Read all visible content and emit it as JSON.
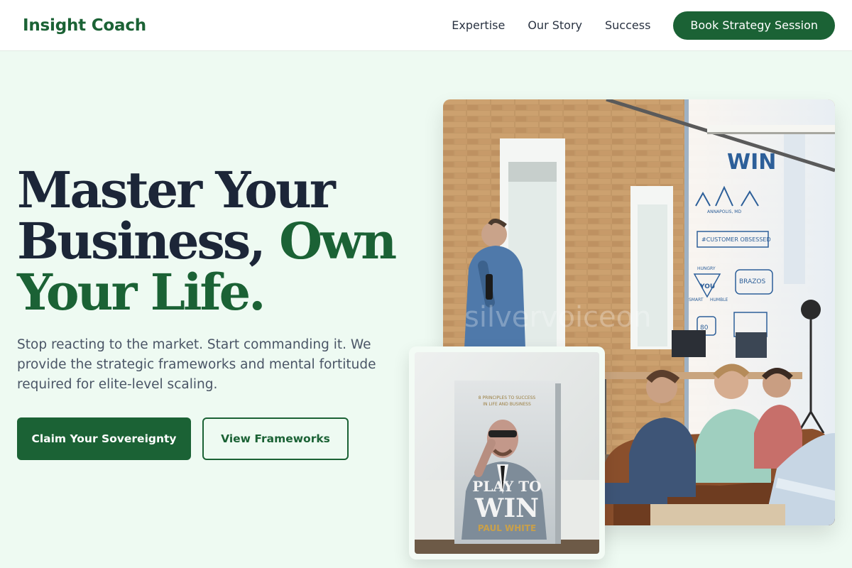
{
  "nav": {
    "brand": "Insight Coach",
    "links": [
      "Expertise",
      "Our Story",
      "Success"
    ],
    "cta": "Book Strategy Session"
  },
  "hero": {
    "title_line1": "Master Your",
    "title_line2_dark": "Business,",
    "title_line2_accent": "Own",
    "title_line3_accent": "Your Life.",
    "subtitle": "Stop reacting to the market. Start commanding it. We provide the strategic frameworks and mental fortitude required for elite-level scaling.",
    "primary_button": "Claim Your Sovereignty",
    "secondary_button": "View Frameworks"
  },
  "photo_main": {
    "mural_win": "WIN",
    "mural_city": "ANNAPOLIS, MD",
    "mural_banner": "#CUSTOMER OBSESSED",
    "mural_hungry": "HUNGRY",
    "mural_you": "YOU",
    "mural_smart": "SMART",
    "mural_humble": "HUMBLE",
    "mural_brazos": "BRAZOS",
    "mural_80": "80",
    "watermark": "silvervoiceon"
  },
  "photo_book": {
    "tagline_1": "8 PRINCIPLES TO SUCCESS",
    "tagline_2": "IN LIFE AND BUSINESS",
    "title_1": "PLAY TO",
    "title_2": "WIN",
    "author": "PAUL WHITE"
  },
  "colors": {
    "accent": "#1b6235",
    "heading": "#1c2638",
    "background": "#eefaf2"
  }
}
